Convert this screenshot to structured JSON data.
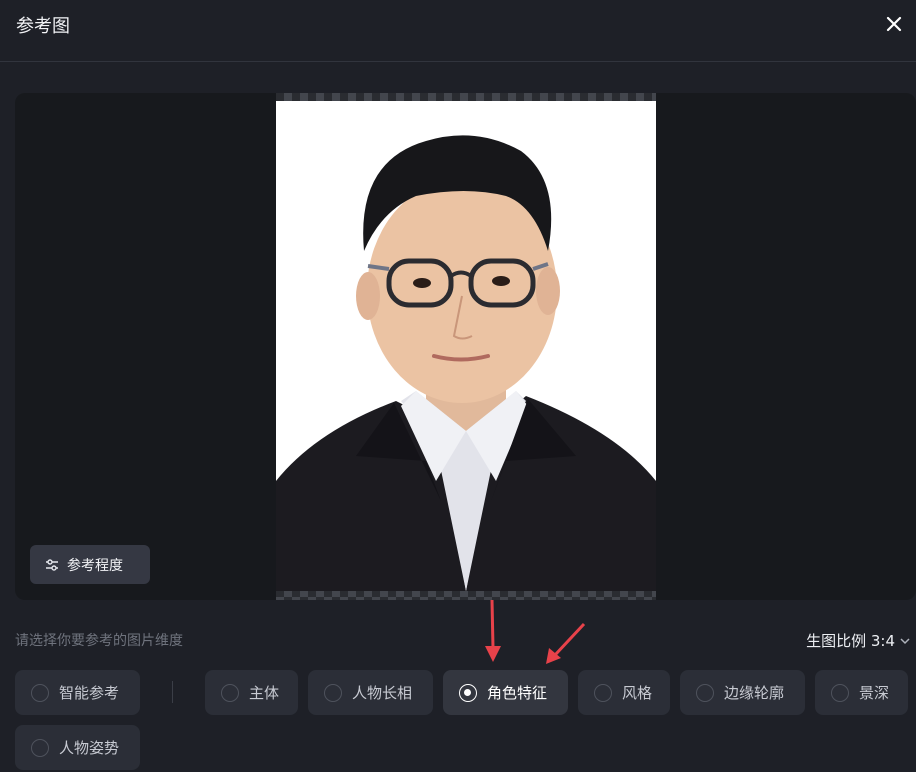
{
  "dialog": {
    "title": "参考图"
  },
  "preview": {
    "strength_button_label": "参考程度"
  },
  "hint": "请选择你要参考的图片维度",
  "ratio": {
    "label": "生图比例 3:4"
  },
  "options": [
    {
      "label": "智能参考",
      "selected": false
    },
    {
      "label": "主体",
      "selected": false
    },
    {
      "label": "人物长相",
      "selected": false
    },
    {
      "label": "角色特征",
      "selected": true
    },
    {
      "label": "风格",
      "selected": false
    },
    {
      "label": "边缘轮廓",
      "selected": false
    },
    {
      "label": "景深",
      "selected": false
    },
    {
      "label": "人物姿势",
      "selected": false
    }
  ],
  "colors": {
    "background": "#1e2027",
    "option_bg": "#2b2e37",
    "annotation_arrow": "#e8424a"
  },
  "icons": [
    "close-icon",
    "sliders-icon",
    "chevron-down-icon",
    "radio-icon"
  ]
}
